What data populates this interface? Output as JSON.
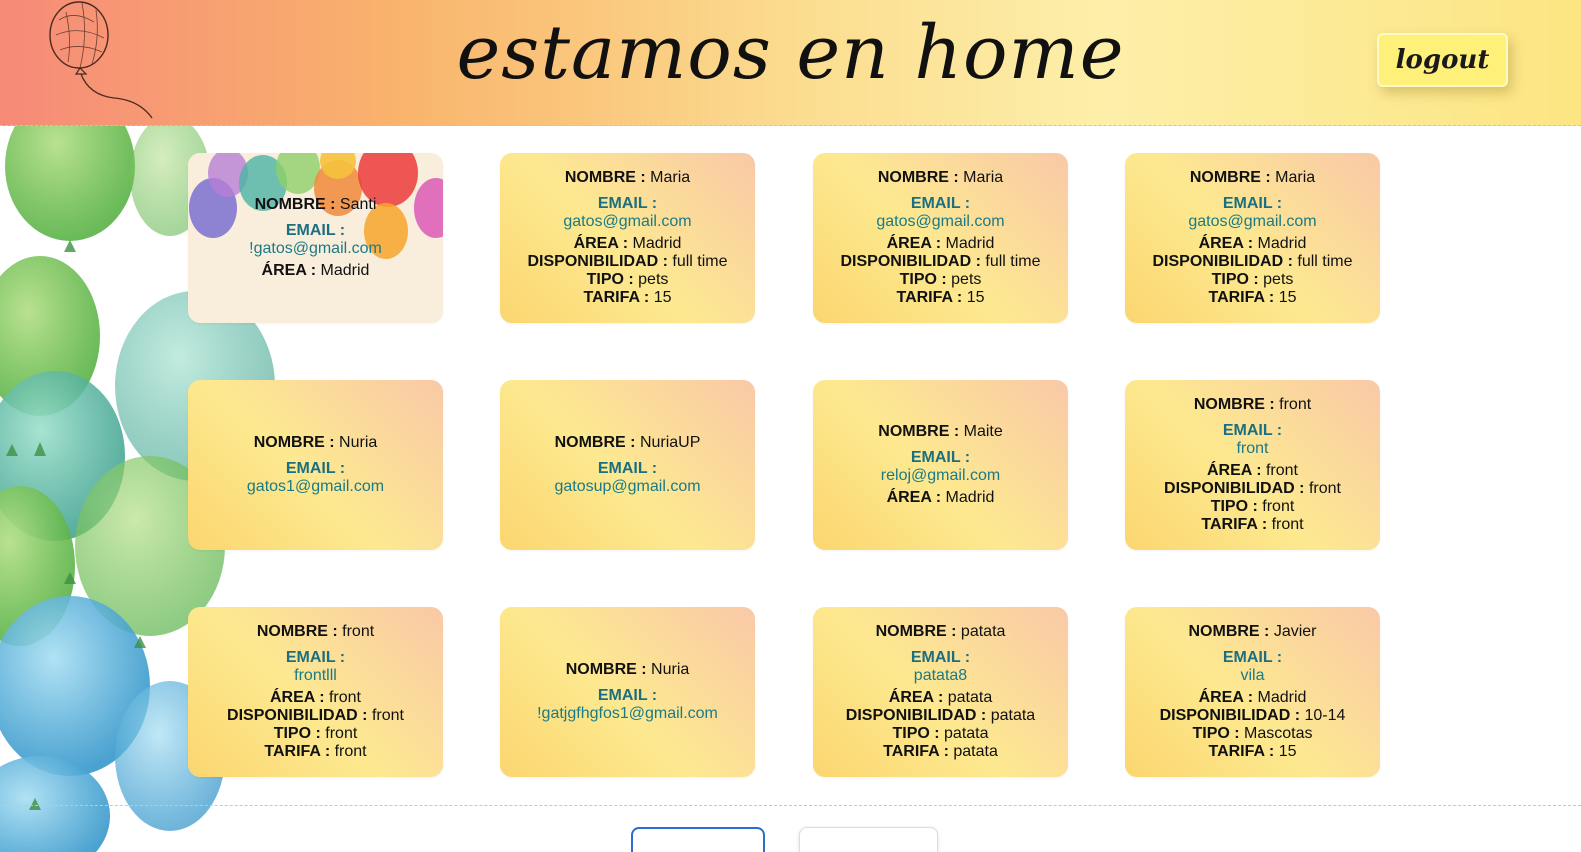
{
  "header": {
    "title": "estamos en home",
    "logout_label": "logout"
  },
  "labels": {
    "nombre": "NOMBRE :",
    "email": "EMAIL :",
    "area": "ÁREA :",
    "disponibilidad": "DISPONIBILIDAD :",
    "tipo": "TIPO :",
    "tarifa": "TARIFA :"
  },
  "cards": [
    {
      "nombre": "Santi",
      "email": "!gatos@gmail.com",
      "area": "Madrid"
    },
    {
      "nombre": "Maria",
      "email": "gatos@gmail.com",
      "area": "Madrid",
      "disponibilidad": "full time",
      "tipo": "pets",
      "tarifa": "15"
    },
    {
      "nombre": "Maria",
      "email": "gatos@gmail.com",
      "area": "Madrid",
      "disponibilidad": "full time",
      "tipo": "pets",
      "tarifa": "15"
    },
    {
      "nombre": "Maria",
      "email": "gatos@gmail.com",
      "area": "Madrid",
      "disponibilidad": "full time",
      "tipo": "pets",
      "tarifa": "15"
    },
    {
      "nombre": "Nuria",
      "email": "gatos1@gmail.com"
    },
    {
      "nombre": "NuriaUP",
      "email": "gatosup@gmail.com"
    },
    {
      "nombre": "Maite",
      "email": "reloj@gmail.com",
      "area": "Madrid"
    },
    {
      "nombre": "front",
      "email": "front",
      "area": "front",
      "disponibilidad": "front",
      "tipo": "front",
      "tarifa": "front"
    },
    {
      "nombre": "front",
      "email": "frontlll",
      "area": "front",
      "disponibilidad": "front",
      "tipo": "front",
      "tarifa": "front"
    },
    {
      "nombre": "Nuria",
      "email": "!gatjgfhgfos1@gmail.com"
    },
    {
      "nombre": "patata",
      "email": "patata8",
      "area": "patata",
      "disponibilidad": "patata",
      "tipo": "patata",
      "tarifa": "patata"
    },
    {
      "nombre": "Javier",
      "email": "vila",
      "area": "Madrid",
      "disponibilidad": "10-14",
      "tipo": "Mascotas",
      "tarifa": "15"
    }
  ],
  "colors": {
    "accent_email": "#1b7a86",
    "logout_bg": "#fff07a",
    "pagination_active_border": "#2a6fd0"
  }
}
